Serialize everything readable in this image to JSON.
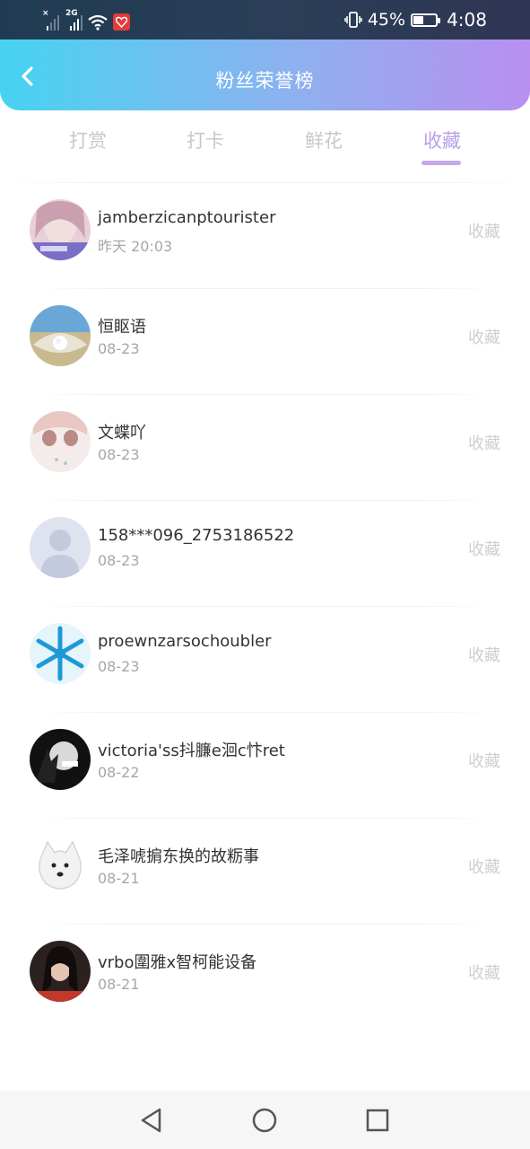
{
  "status_bar": {
    "signal1_tag": "×",
    "signal2_tag": "2G",
    "battery_percent": "45%",
    "battery_level": 0.45,
    "time": "4:08",
    "icons": [
      "signal-icon",
      "wifi-icon",
      "app-notification-icon",
      "vibrate-icon",
      "battery-charging-icon"
    ]
  },
  "header": {
    "title": "粉丝荣誉榜",
    "gradient_colors": [
      "#46d3f1",
      "#8db1ef",
      "#b98ff0"
    ]
  },
  "tabs": [
    {
      "label": "打赏",
      "active": false
    },
    {
      "label": "打卡",
      "active": false
    },
    {
      "label": "鲜花",
      "active": false
    },
    {
      "label": "收藏",
      "active": true
    }
  ],
  "accent_color": "#b9a0e8",
  "fans": [
    {
      "name": "jamberzicanptourister",
      "date": "昨天 20:03",
      "action": "收藏"
    },
    {
      "name": "恒眍语",
      "date": "08-23",
      "action": "收藏"
    },
    {
      "name": "文蝶吖",
      "date": "08-23",
      "action": "收藏"
    },
    {
      "name": "158***096_2753186522",
      "date": "08-23",
      "action": "收藏"
    },
    {
      "name": "proewnzarsochoubler",
      "date": "08-23",
      "action": "收藏"
    },
    {
      "name": "victoria'ss抖臁e洄c忭ret",
      "date": "08-22",
      "action": "收藏"
    },
    {
      "name": "毛泽唬掮东换的故粝事",
      "date": "08-21",
      "action": "收藏"
    },
    {
      "name": "vrbo圍雅x智柯能设备",
      "date": "08-21",
      "action": "收藏"
    }
  ],
  "nav_bar": {
    "icons": [
      "back-triangle-icon",
      "home-circle-icon",
      "recents-square-icon"
    ]
  }
}
